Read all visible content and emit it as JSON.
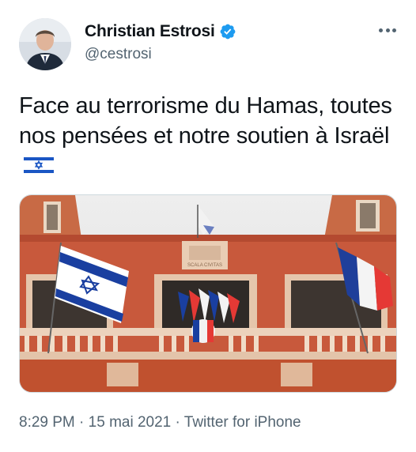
{
  "author": {
    "name": "Christian Estrosi",
    "handle": "@cestrosi",
    "verified": true,
    "avatar_icon": "portrait-avatar"
  },
  "tweet": {
    "text": "Face au terrorisme du Hamas, toutes nos pensées et notre soutien à Israël",
    "flag_emoji": "israel-flag-emoji"
  },
  "media": {
    "building_sign": "SCALA CIVITAS",
    "description_icon": "photo-city-hall-flags"
  },
  "meta": {
    "time": "8:29 PM",
    "separator": "·",
    "date": "15 mai 2021",
    "source": "Twitter for iPhone"
  },
  "colors": {
    "text": "#0f1419",
    "secondary": "#536471",
    "verified_blue": "#1d9bf0",
    "facade": "#c8593c",
    "israel_blue": "#1a3fa0"
  }
}
